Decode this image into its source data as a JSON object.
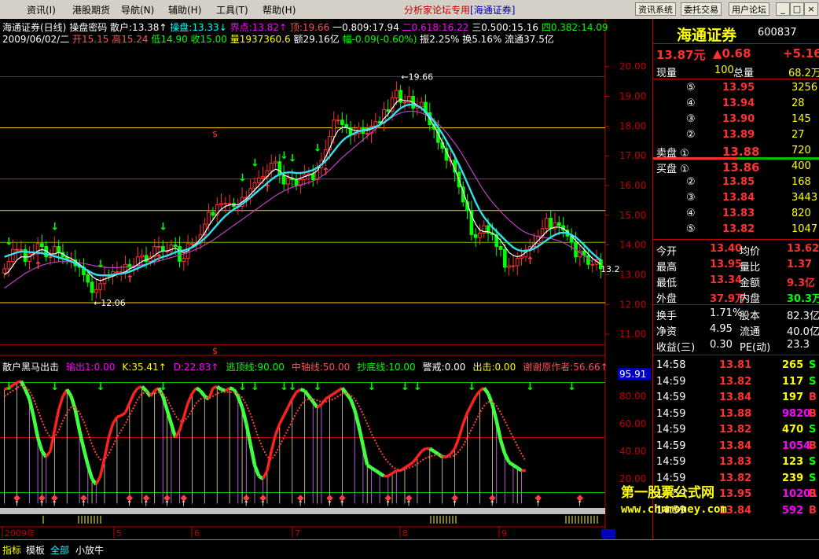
{
  "menu": [
    "资讯(I)",
    "港股期货",
    "导航(N)",
    "辅助(H)",
    "工具(T)",
    "帮助(H)"
  ],
  "window_title": "分析家论坛专用",
  "window_subtitle": "[海通证券]",
  "top_buttons": [
    "资讯系统",
    "委托交易",
    "用户论坛"
  ],
  "win_controls": [
    "_",
    "□",
    "×"
  ],
  "info_line1": {
    "name": "海通证券(日线)",
    "label2": "操盘密码",
    "items": [
      {
        "t": "散户:13.38↑",
        "c": "#ffffff"
      },
      {
        "t": "操盘:13.33↓",
        "c": "#00ffff"
      },
      {
        "t": "界点:13.82↑",
        "c": "#ff00ff"
      },
      {
        "t": "顶:19.66",
        "c": "#ff5050"
      },
      {
        "t": "一0.809:17.94",
        "c": "#ffffff"
      },
      {
        "t": "二0.618:16.22",
        "c": "#ff00ff"
      },
      {
        "t": "三0.500:15.16",
        "c": "#ffffff"
      },
      {
        "t": "四0.382:14.09",
        "c": "#00ff00"
      }
    ]
  },
  "info_line2": [
    {
      "t": "2009/06/02/二",
      "c": "#ffffff"
    },
    {
      "t": "开15.15",
      "c": "#ff5050"
    },
    {
      "t": "高15.24",
      "c": "#ff5050"
    },
    {
      "t": "低14.90",
      "c": "#00ff00"
    },
    {
      "t": "收15.00",
      "c": "#00ff00"
    },
    {
      "t": "量1937360.6",
      "c": "#ffff00"
    },
    {
      "t": "额29.16亿",
      "c": "#ffffff"
    },
    {
      "t": "幅-0.09(-0.60%)",
      "c": "#00ff00"
    },
    {
      "t": "振2.25%",
      "c": "#ffffff"
    },
    {
      "t": "换5.16%",
      "c": "#ffffff"
    },
    {
      "t": "流通37.5亿",
      "c": "#ffffff"
    }
  ],
  "indicator_line": [
    {
      "t": "散户黑马出击",
      "c": "#ffffff"
    },
    {
      "t": "输出1:0.00",
      "c": "#ff00ff"
    },
    {
      "t": "K:35.41↑",
      "c": "#ffff00"
    },
    {
      "t": "D:22.83↑",
      "c": "#ff00ff"
    },
    {
      "t": "逃顶线:90.00",
      "c": "#00ff00"
    },
    {
      "t": "中轴线:50.00",
      "c": "#ff5050"
    },
    {
      "t": "抄底线:10.00",
      "c": "#00ff00"
    },
    {
      "t": "警戒:0.00",
      "c": "#ffffff"
    },
    {
      "t": "出击:0.00",
      "c": "#ffff00"
    },
    {
      "t": "谢谢原作者:56.66↑",
      "c": "#ff5050"
    }
  ],
  "price_axis": [
    "20.00",
    "19.00",
    "18.00",
    "17.00",
    "16.00",
    "15.00",
    "14.00",
    "13.00",
    "12.00",
    "11.00"
  ],
  "ind_axis": [
    "95.91",
    "80.00",
    "60.00",
    "40.00",
    "20.00"
  ],
  "annotations": {
    "high": "19.66",
    "low": "12.06",
    "last": "13.2",
    "s_mark": "$"
  },
  "date_axis": [
    "2009年",
    "5",
    "6",
    "7",
    "8",
    "9"
  ],
  "chart_data": {
    "type": "candlestick",
    "ylim": [
      10.5,
      20.6
    ],
    "open": [
      13.05,
      13.2,
      13.45,
      13.85,
      13.85,
      13.85,
      13.45,
      13.7,
      13.7,
      14.05,
      13.95,
      13.6,
      13.6,
      13.95,
      13.75,
      13.6,
      13.5,
      13.5,
      13.3,
      13.25,
      13.0,
      12.75,
      12.4,
      12.5,
      12.7,
      13.0,
      12.95,
      13.1,
      13.1,
      13.1,
      13.35,
      13.25,
      13.3,
      13.6,
      13.65,
      13.45,
      13.6,
      13.95,
      13.95,
      13.8,
      13.8,
      14.0,
      13.95,
      13.45,
      13.55,
      14.05,
      14.05,
      14.05,
      14.35,
      14.7,
      15.1,
      15.0,
      15.35,
      15.4,
      15.4,
      15.4,
      15.3,
      15.3,
      15.6,
      15.6,
      15.9,
      16.1,
      16.25,
      16.3,
      16.5,
      16.75,
      16.8,
      16.35,
      16.05,
      16.25,
      16.2,
      16.0,
      16.2,
      16.35,
      16.4,
      16.2,
      16.6,
      16.85,
      17.2,
      17.65,
      18.2,
      18.2,
      18.05,
      17.95,
      17.7,
      17.75,
      17.95,
      17.75,
      17.75,
      18.0,
      18.15,
      18.1,
      18.55,
      18.5,
      18.95,
      19.2,
      18.8,
      18.8,
      19.0,
      18.6,
      18.65,
      18.8,
      18.45,
      18.05,
      17.9,
      17.45,
      17.25,
      16.85,
      16.85,
      16.45,
      15.95,
      15.45,
      15.15,
      14.35,
      14.25,
      14.4,
      14.65,
      14.4,
      14.35,
      13.95,
      13.85,
      13.25,
      13.3,
      13.3,
      13.55,
      13.6,
      13.85,
      13.95,
      14.05,
      14.3,
      14.55,
      14.9,
      14.55,
      14.75,
      14.65,
      14.5,
      14.3,
      14.1,
      13.6,
      13.8,
      13.65,
      13.35,
      13.35,
      13.5
    ],
    "close": [
      13.2,
      13.45,
      13.85,
      13.85,
      13.85,
      13.45,
      13.7,
      13.7,
      14.05,
      13.95,
      13.6,
      13.6,
      13.95,
      13.75,
      13.6,
      13.5,
      13.5,
      13.3,
      13.25,
      13.0,
      12.75,
      12.4,
      12.5,
      12.7,
      13.0,
      12.95,
      13.1,
      13.1,
      13.1,
      13.35,
      13.25,
      13.3,
      13.6,
      13.65,
      13.45,
      13.6,
      13.95,
      13.95,
      13.8,
      13.8,
      14.0,
      13.95,
      13.45,
      13.55,
      14.05,
      14.05,
      14.05,
      14.35,
      14.7,
      15.1,
      15.0,
      15.35,
      15.4,
      15.4,
      15.4,
      15.3,
      15.3,
      15.6,
      15.6,
      15.9,
      16.1,
      16.25,
      16.3,
      16.5,
      16.75,
      16.8,
      16.35,
      16.05,
      16.25,
      16.2,
      16.0,
      16.2,
      16.35,
      16.4,
      16.2,
      16.6,
      16.85,
      17.2,
      17.65,
      18.2,
      18.2,
      18.05,
      17.95,
      17.7,
      17.75,
      17.95,
      17.75,
      17.75,
      18.0,
      18.15,
      18.1,
      18.55,
      18.5,
      18.95,
      19.2,
      18.8,
      18.8,
      19.0,
      18.6,
      18.65,
      18.8,
      18.45,
      18.05,
      17.9,
      17.45,
      17.25,
      16.85,
      16.85,
      16.45,
      15.95,
      15.45,
      15.15,
      14.35,
      14.25,
      14.4,
      14.65,
      14.4,
      14.35,
      13.95,
      13.85,
      13.25,
      13.3,
      13.3,
      13.55,
      13.6,
      13.85,
      13.95,
      14.05,
      14.3,
      14.55,
      14.9,
      14.55,
      14.75,
      14.65,
      14.5,
      14.3,
      14.1,
      13.6,
      13.8,
      13.65,
      13.35,
      13.35,
      13.5,
      13.2
    ],
    "ma_white": [
      13.0,
      13.1,
      13.3,
      13.5,
      13.6,
      13.6,
      13.6,
      13.7,
      13.8,
      13.85,
      13.8,
      13.7,
      13.7,
      13.75,
      13.7,
      13.6,
      13.55,
      13.45,
      13.35,
      13.25,
      13.1,
      12.95,
      12.85,
      12.8,
      12.85,
      12.9,
      12.95,
      13.0,
      13.05,
      13.1,
      13.2,
      13.25,
      13.35,
      13.45,
      13.5,
      13.55,
      13.65,
      13.75,
      13.8,
      13.8,
      13.85,
      13.9,
      13.8,
      13.75,
      13.8,
      13.95,
      14.05,
      14.2,
      14.4,
      14.65,
      14.85,
      15.05,
      15.2,
      15.3,
      15.35,
      15.35,
      15.35,
      15.45,
      15.55,
      15.7,
      15.85,
      16.0,
      16.15,
      16.3,
      16.45,
      16.55,
      16.5,
      16.35,
      16.3,
      16.25,
      16.2,
      16.25,
      16.3,
      16.35,
      16.4,
      16.5,
      16.7,
      16.95,
      17.25,
      17.6,
      17.85,
      17.95,
      17.95,
      17.9,
      17.85,
      17.85,
      17.85,
      17.85,
      17.9,
      17.95,
      18.05,
      18.25,
      18.4,
      18.6,
      18.8,
      18.9,
      18.85,
      18.85,
      18.8,
      18.7,
      18.6,
      18.45,
      18.25,
      18.0,
      17.75,
      17.45,
      17.15,
      16.85,
      16.55,
      16.2,
      15.8,
      15.4,
      15.0,
      14.7,
      14.5,
      14.45,
      14.45,
      14.4,
      14.3,
      14.15,
      13.95,
      13.75,
      13.65,
      13.6,
      13.65,
      13.75,
      13.85,
      14.0,
      14.15,
      14.3,
      14.45,
      14.55,
      14.6,
      14.6,
      14.55,
      14.45,
      14.3,
      14.15,
      14.0,
      13.85,
      13.7,
      13.55,
      13.45,
      13.35
    ],
    "ma_cyan": [
      13.6,
      13.65,
      13.7,
      13.75,
      13.78,
      13.78,
      13.76,
      13.75,
      13.74,
      13.72,
      13.7,
      13.66,
      13.62,
      13.58,
      13.54,
      13.5,
      13.45,
      13.38,
      13.3,
      13.22,
      13.14,
      13.06,
      13.0,
      12.98,
      12.98,
      12.98,
      13.0,
      13.02,
      13.04,
      13.06,
      13.1,
      13.16,
      13.22,
      13.28,
      13.34,
      13.4,
      13.48,
      13.55,
      13.6,
      13.64,
      13.7,
      13.76,
      13.8,
      13.82,
      13.86,
      13.92,
      14.0,
      14.1,
      14.22,
      14.36,
      14.52,
      14.68,
      14.84,
      14.98,
      15.1,
      15.2,
      15.28,
      15.38,
      15.48,
      15.6,
      15.72,
      15.84,
      15.96,
      16.08,
      16.2,
      16.3,
      16.38,
      16.42,
      16.44,
      16.44,
      16.42,
      16.42,
      16.44,
      16.48,
      16.52,
      16.6,
      16.7,
      16.82,
      16.98,
      17.16,
      17.34,
      17.5,
      17.62,
      17.7,
      17.76,
      17.82,
      17.86,
      17.9,
      17.94,
      17.98,
      18.04,
      18.12,
      18.22,
      18.34,
      18.48,
      18.6,
      18.68,
      18.72,
      18.72,
      18.68,
      18.6,
      18.48,
      18.34,
      18.16,
      17.96,
      17.74,
      17.5,
      17.24,
      16.98,
      16.7,
      16.4,
      16.08,
      15.76,
      15.44,
      15.16,
      14.94,
      14.76,
      14.6,
      14.46,
      14.32,
      14.18,
      14.04,
      13.92,
      13.84,
      13.8,
      13.8,
      13.82,
      13.88,
      13.96,
      14.06,
      14.16,
      14.26,
      14.34,
      14.4,
      14.42,
      14.4,
      14.34,
      14.26,
      14.14,
      14.0,
      13.86,
      13.72,
      13.6,
      13.48
    ],
    "ma_purple": [
      12.55,
      12.65,
      12.75,
      12.85,
      12.95,
      13.05,
      13.12,
      13.2,
      13.26,
      13.32,
      13.36,
      13.4,
      13.42,
      13.44,
      13.44,
      13.44,
      13.43,
      13.42,
      13.4,
      13.38,
      13.35,
      13.32,
      13.29,
      13.27,
      13.25,
      13.24,
      13.24,
      13.24,
      13.25,
      13.26,
      13.27,
      13.29,
      13.31,
      13.33,
      13.36,
      13.39,
      13.42,
      13.46,
      13.5,
      13.54,
      13.58,
      13.62,
      13.66,
      13.7,
      13.74,
      13.8,
      13.86,
      13.92,
      14.0,
      14.08,
      14.16,
      14.26,
      14.36,
      14.46,
      14.56,
      14.66,
      14.76,
      14.86,
      14.96,
      15.06,
      15.16,
      15.26,
      15.36,
      15.46,
      15.56,
      15.66,
      15.74,
      15.82,
      15.88,
      15.94,
      15.98,
      16.02,
      16.06,
      16.1,
      16.16,
      16.22,
      16.3,
      16.4,
      16.52,
      16.66,
      16.8,
      16.94,
      17.06,
      17.18,
      17.3,
      17.42,
      17.54,
      17.66,
      17.78,
      17.9,
      18.02,
      18.12,
      18.22,
      18.3,
      18.38,
      18.44,
      18.48,
      18.5,
      18.5,
      18.48,
      18.44,
      18.38,
      18.3,
      18.2,
      18.08,
      17.94,
      17.78,
      17.6,
      17.42,
      17.22,
      17.0,
      16.76,
      16.52,
      16.28,
      16.04,
      15.82,
      15.62,
      15.44,
      15.28,
      15.12,
      14.98,
      14.84,
      14.72,
      14.6,
      14.5,
      14.42,
      14.36,
      14.32,
      14.28,
      14.26,
      14.24,
      14.22,
      14.18,
      14.14,
      14.08,
      14.0,
      13.92,
      13.84,
      13.74,
      13.64,
      13.54,
      13.44
    ],
    "fib_lines": [
      19.66,
      17.94,
      16.22,
      15.16,
      14.09,
      12.06,
      10.65
    ],
    "ind_k": [
      85,
      86,
      88,
      90,
      91,
      85,
      78,
      65,
      50,
      40,
      36,
      40,
      55,
      70,
      80,
      85,
      80,
      70,
      55,
      42,
      30,
      20,
      16,
      22,
      35,
      50,
      60,
      65,
      66,
      68,
      75,
      82,
      86,
      87,
      84,
      80,
      84,
      86,
      80,
      70,
      60,
      50,
      55,
      65,
      75,
      82,
      86,
      84,
      80,
      78,
      86,
      87,
      85,
      84,
      86,
      85,
      80,
      72,
      60,
      45,
      30,
      22,
      20,
      26,
      40,
      52,
      60,
      66,
      72,
      78,
      83,
      85,
      84,
      80,
      76,
      72,
      74,
      78,
      80,
      82,
      84,
      86,
      82,
      78,
      70,
      58,
      44,
      30,
      28,
      26,
      24,
      22,
      22,
      24,
      26,
      26,
      28,
      30,
      32,
      36,
      40,
      42,
      42,
      40,
      38,
      36,
      36,
      38,
      42,
      50,
      60,
      68,
      74,
      80,
      84,
      86,
      82,
      74,
      62,
      48,
      38,
      32,
      30,
      28,
      26,
      26
    ],
    "ind_d": [
      80,
      82,
      84,
      86,
      88,
      87,
      84,
      78,
      70,
      62,
      55,
      50,
      50,
      55,
      62,
      68,
      72,
      72,
      68,
      62,
      54,
      45,
      38,
      34,
      34,
      38,
      44,
      50,
      55,
      60,
      66,
      72,
      78,
      82,
      83,
      82,
      82,
      83,
      82,
      78,
      72,
      66,
      62,
      62,
      65,
      70,
      75,
      78,
      79,
      79,
      80,
      82,
      83,
      83,
      83,
      83,
      82,
      79,
      74,
      67,
      58,
      49,
      42,
      36,
      34,
      38,
      44,
      50,
      56,
      62,
      68,
      73,
      77,
      78,
      78,
      77,
      76,
      76,
      77,
      78,
      80,
      82,
      82,
      81,
      78,
      73,
      67,
      60,
      53,
      47,
      41,
      36,
      32,
      29,
      27,
      26,
      27,
      28,
      29,
      31,
      33,
      35,
      36,
      37,
      37,
      37,
      36,
      36,
      37,
      40,
      44,
      50,
      56,
      62,
      68,
      73,
      76,
      76,
      73,
      68,
      62,
      56,
      50,
      44,
      38,
      33
    ],
    "down_arrows_pct": [
      1,
      12,
      23,
      38,
      57,
      60,
      67,
      69,
      75,
      88,
      96,
      99,
      112,
      126,
      136,
      144,
      154,
      163
    ],
    "up_markers_pct": [
      3,
      9,
      12,
      19,
      30,
      34,
      39,
      43,
      58,
      62,
      71,
      78,
      81,
      92,
      97,
      108,
      117,
      128,
      138,
      145,
      150
    ],
    "x_count": 151
  },
  "right_panel": {
    "name": "海通证券",
    "code": "600837",
    "price": "13.87元",
    "change": "▲0.68",
    "pct": "+5.16",
    "vol_label": "现量",
    "vol": "100",
    "total_label": "总量",
    "total": "68.2万",
    "sells": [
      [
        "⑤",
        "13.95",
        "3256"
      ],
      [
        "④",
        "13.94",
        "28"
      ],
      [
        "③",
        "13.90",
        "145"
      ],
      [
        "②",
        "13.89",
        "27"
      ],
      [
        "卖盘 ①",
        "13.88",
        "720"
      ]
    ],
    "buys": [
      [
        "买盘 ①",
        "13.86",
        "400"
      ],
      [
        "②",
        "13.85",
        "168"
      ],
      [
        "③",
        "13.84",
        "3443"
      ],
      [
        "④",
        "13.83",
        "820"
      ],
      [
        "⑤",
        "13.82",
        "1047"
      ]
    ],
    "stats": [
      [
        "今开",
        "13.40",
        "均价",
        "13.62"
      ],
      [
        "最高",
        "13.95",
        "量比",
        "1.37"
      ],
      [
        "最低",
        "13.34",
        "金额",
        "9.3亿"
      ],
      [
        "外盘",
        "37.9万",
        "内盘",
        "30.3万"
      ]
    ],
    "stats2": [
      [
        "换手",
        "1.71%",
        "股本",
        "82.3亿"
      ],
      [
        "净资",
        "4.95",
        "流通",
        "40.0亿"
      ],
      [
        "收益(三)",
        "0.30",
        "PE(动)",
        "23.3"
      ]
    ],
    "ticks": [
      [
        "14:58",
        "13.81",
        "265",
        "S"
      ],
      [
        "14:59",
        "13.82",
        "117",
        "S"
      ],
      [
        "14:59",
        "13.84",
        "197",
        "B"
      ],
      [
        "14:59",
        "13.88",
        "9820",
        "B"
      ],
      [
        "14:59",
        "13.82",
        "470",
        "S"
      ],
      [
        "14:59",
        "13.84",
        "1054",
        "B"
      ],
      [
        "14:59",
        "13.83",
        "123",
        "S"
      ],
      [
        "14:59",
        "13.82",
        "239",
        "S"
      ],
      [
        "14:59",
        "13.95",
        "10201",
        "B"
      ],
      [
        "14:59",
        "13.84",
        "592",
        "B"
      ]
    ]
  },
  "watermark": {
    "cn": "第一股票公式网",
    "url": "www.chnmoney.com"
  },
  "bottom_tabs": [
    "指标",
    "模板",
    "全部",
    "小放牛"
  ],
  "colors": {
    "up": "#ff3030",
    "down": "#00ff00",
    "bg": "#000000",
    "grid_red": "#c00000"
  }
}
